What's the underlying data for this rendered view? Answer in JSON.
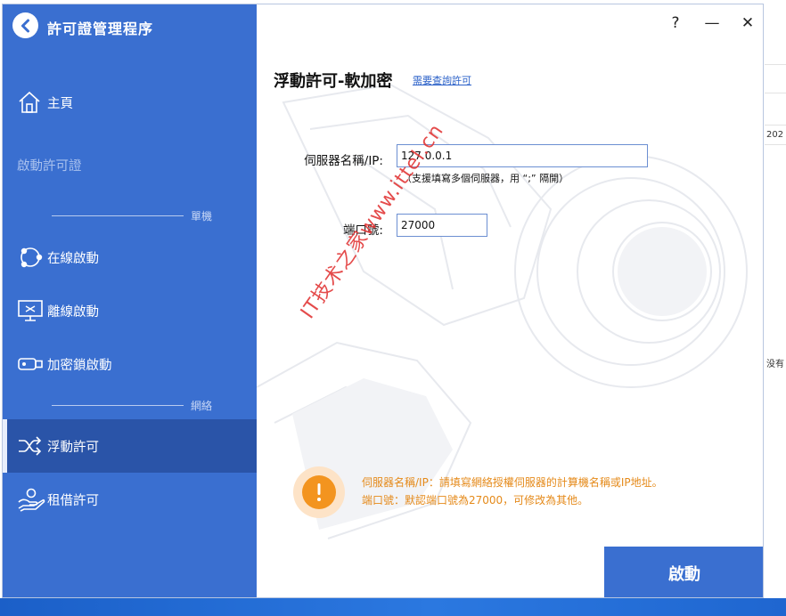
{
  "app": {
    "title": "許可證管理程序"
  },
  "window_controls": {
    "help": "?",
    "minimize": "—",
    "close": "✕"
  },
  "sidebar": {
    "home": "主頁",
    "activate_license": "啟動許可證",
    "section_standalone": "單機",
    "online": "在線啟動",
    "offline": "離線啟動",
    "dongle": "加密鎖啟動",
    "section_network": "網絡",
    "floating": "浮動許可",
    "borrow": "租借許可"
  },
  "main": {
    "title": "浮動許可-軟加密",
    "inquire_link": "需要查詢許可",
    "server_label": "伺服器名稱/IP:",
    "server_value": "127.0.0.1",
    "server_hint": "（支援填寫多個伺服器，用 “;” 隔開）",
    "port_label": "端口號:",
    "port_value": "27000",
    "info_line1": "伺服器名稱/IP：請填寫網絡授權伺服器的計算機名稱或IP地址。",
    "info_line2": "端口號：默認端口號為27000，可修改為其他。",
    "activate_button": "啟動",
    "watermark": "IT技术之家www.ittel.cn"
  },
  "desktop": {
    "partial_text_1": "202",
    "partial_text_2": "没有"
  },
  "colors": {
    "sidebar": "#3a6fd0",
    "sidebar_active": "#2a54a8",
    "accent_orange": "#f3941f",
    "info_text": "#e58a1a"
  }
}
